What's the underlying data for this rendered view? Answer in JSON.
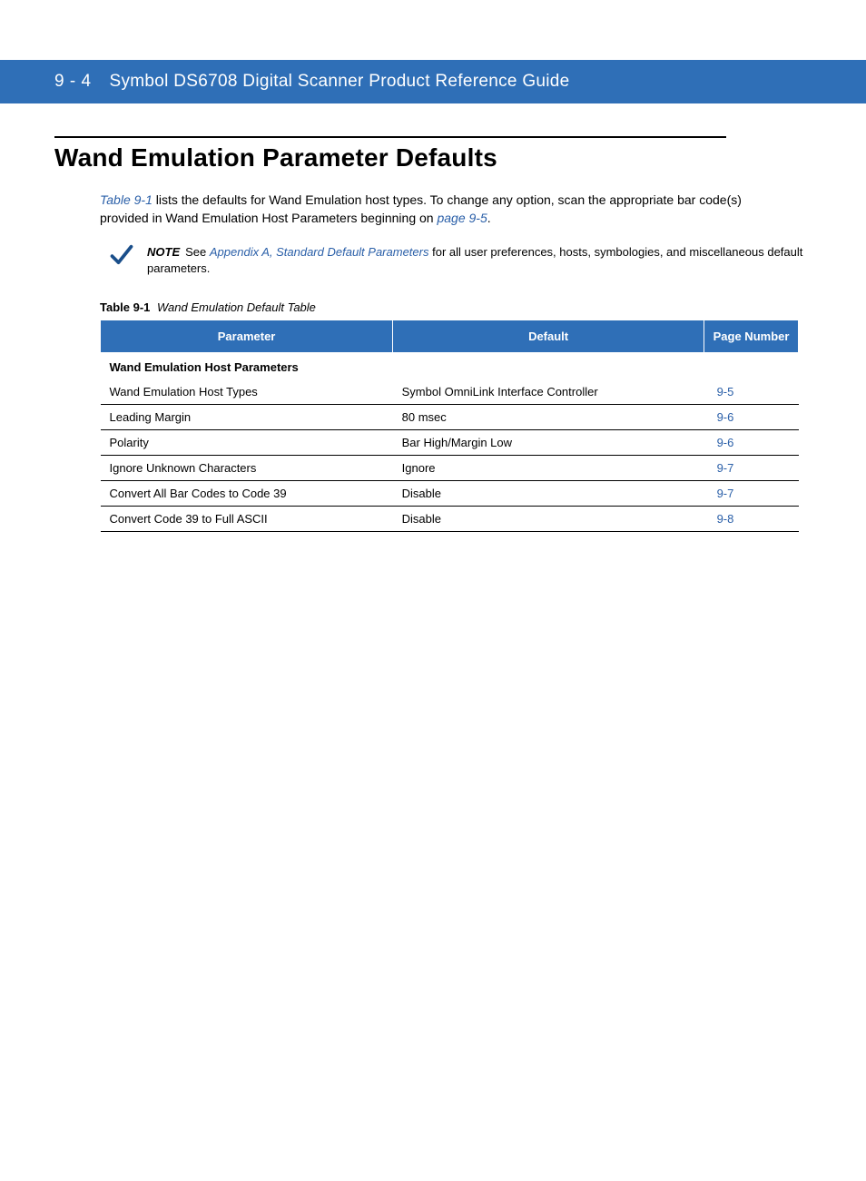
{
  "header": {
    "page_label": "9 - 4",
    "doc_title": "Symbol DS6708 Digital Scanner Product Reference Guide"
  },
  "section": {
    "title": "Wand Emulation Parameter Defaults",
    "intro_prefix": "Table 9-1",
    "intro_body": " lists the defaults for Wand Emulation host types. To change any option, scan the appropriate bar code(s) provided in Wand Emulation Host Parameters beginning on ",
    "intro_xref": "page 9-5",
    "intro_suffix": "."
  },
  "note": {
    "label": "NOTE",
    "text_prefix": "See ",
    "text_xref": "Appendix A, Standard Default Parameters",
    "text_suffix": " for all user preferences, hosts, symbologies, and miscellaneous default parameters."
  },
  "table": {
    "caption_label": "Table 9-1",
    "caption_text": "Wand Emulation Default Table",
    "columns": [
      "Parameter",
      "Default",
      "Page Number"
    ],
    "section_row": "Wand Emulation Host Parameters",
    "rows": [
      {
        "param": "Wand Emulation Host Types",
        "default": "Symbol OmniLink Interface Controller",
        "page": "9-5"
      },
      {
        "param": "Leading Margin",
        "default": "80 msec",
        "page": "9-6"
      },
      {
        "param": "Polarity",
        "default": "Bar High/Margin Low",
        "page": "9-6"
      },
      {
        "param": "Ignore Unknown Characters",
        "default": "Ignore",
        "page": "9-7"
      },
      {
        "param": "Convert All Bar Codes to Code 39",
        "default": "Disable",
        "page": "9-7"
      },
      {
        "param": "Convert Code 39 to Full ASCII",
        "default": "Disable",
        "page": "9-8"
      }
    ]
  }
}
